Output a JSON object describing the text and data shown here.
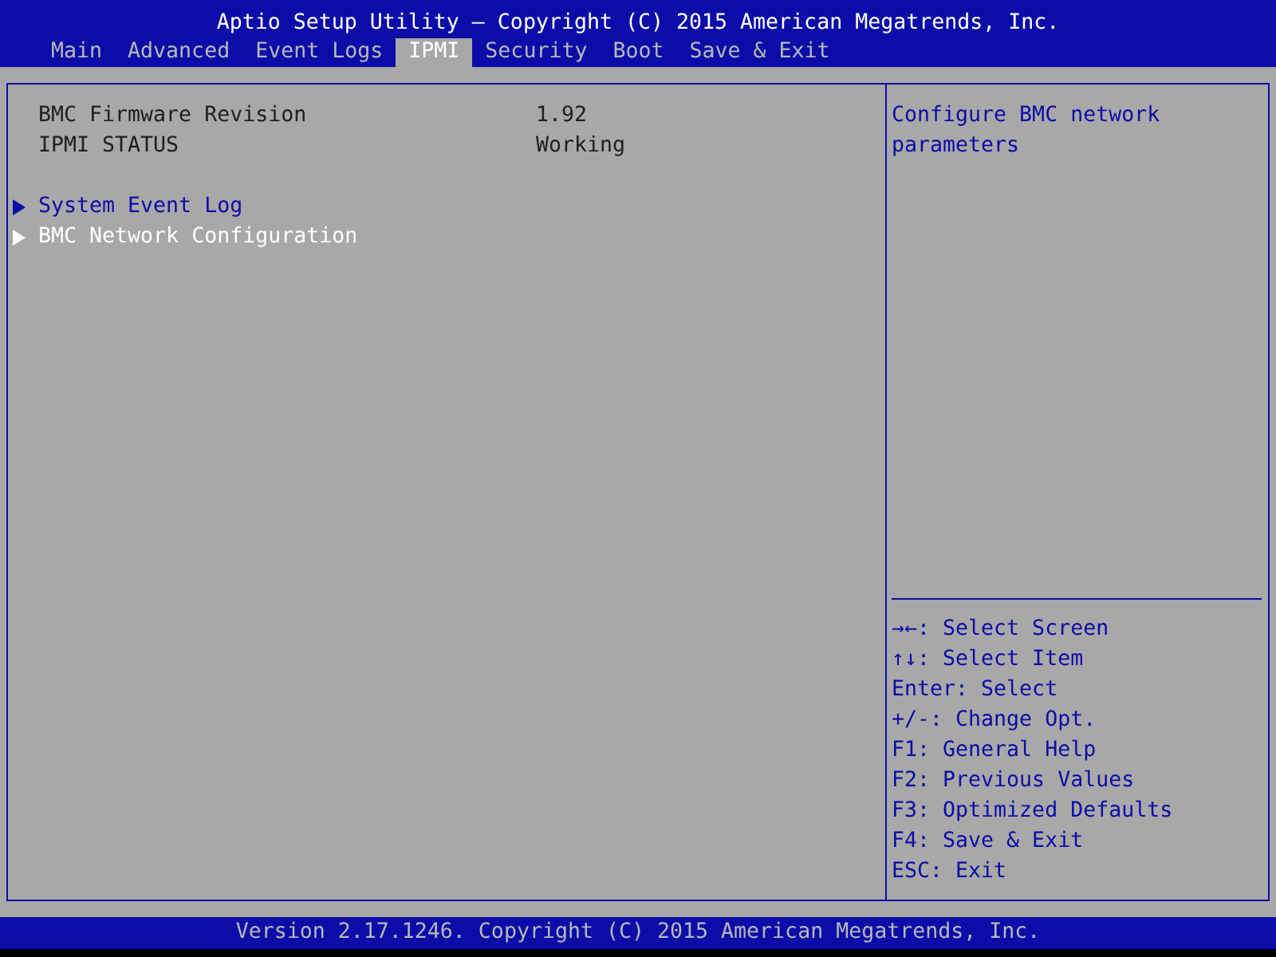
{
  "title": "Aptio Setup Utility – Copyright (C) 2015 American Megatrends, Inc.",
  "tabs": [
    {
      "label": "Main",
      "selected": false
    },
    {
      "label": "Advanced",
      "selected": false
    },
    {
      "label": "Event Logs",
      "selected": false
    },
    {
      "label": "IPMI",
      "selected": true
    },
    {
      "label": "Security",
      "selected": false
    },
    {
      "label": "Boot",
      "selected": false
    },
    {
      "label": "Save & Exit",
      "selected": false
    }
  ],
  "info_rows": [
    {
      "label": "BMC Firmware Revision",
      "value": "1.92"
    },
    {
      "label": "IPMI STATUS",
      "value": "Working"
    }
  ],
  "menu_items": [
    {
      "label": "System Event Log",
      "selected": false
    },
    {
      "label": "BMC Network Configuration",
      "selected": true
    }
  ],
  "help_text": "Configure BMC network parameters",
  "key_hints": [
    "→←: Select Screen",
    "↑↓: Select Item",
    "Enter: Select",
    "+/-: Change Opt.",
    "F1: General Help",
    "F2: Previous Values",
    "F3: Optimized Defaults",
    "F4: Save & Exit",
    "ESC: Exit"
  ],
  "footer": "Version 2.17.1246. Copyright (C) 2015 American Megatrends, Inc."
}
